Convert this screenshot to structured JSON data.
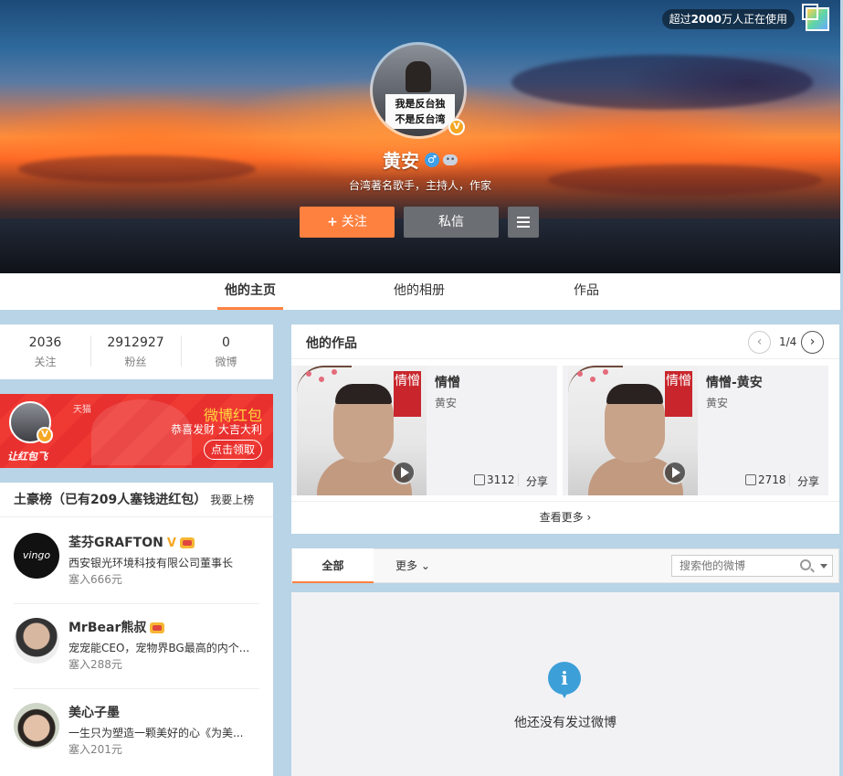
{
  "header": {
    "users_badge_prefix": "超过",
    "users_badge_bold": "2000",
    "users_badge_suffix": "万人正在使用",
    "avatar_sign_line1": "我是反台独",
    "avatar_sign_line2": "不是反台湾",
    "profile_name": "黄安",
    "gender_icon": "male-icon",
    "bio": "台湾著名歌手，主持人，作家",
    "follow_label": "关注",
    "message_label": "私信"
  },
  "nav": {
    "tabs": [
      "他的主页",
      "他的相册",
      "作品"
    ],
    "active": "他的主页"
  },
  "stats": [
    {
      "num": "2036",
      "label": "关注"
    },
    {
      "num": "2912927",
      "label": "粉丝"
    },
    {
      "num": "0",
      "label": "微博"
    }
  ],
  "redpacket": {
    "tmall": "天猫",
    "logo": "让红包飞",
    "title": "微博红包",
    "subtitle": "恭喜发财 大吉大利",
    "button": "点击领取"
  },
  "rich_list": {
    "title": "土豪榜（已有209人塞钱进红包）",
    "link": "我要上榜",
    "items": [
      {
        "name": "荃芬GRAFTON",
        "desc": "西安银光环境科技有限公司董事长",
        "amount": "塞入666元",
        "avatar_text": "vingo",
        "verified": "V"
      },
      {
        "name": "MrBear熊叔",
        "desc": "宠宠能CEO，宠物界BG最高的内个...",
        "amount": "塞入288元"
      },
      {
        "name": "美心子墨",
        "desc": "一生只为塑造一颗美好的心《为美...",
        "amount": "塞入201元"
      }
    ]
  },
  "works": {
    "title": "他的作品",
    "page": "1/4",
    "items": [
      {
        "title": "情憎",
        "artist": "黄安",
        "likes": "3112",
        "share": "分享",
        "seal": "情憎"
      },
      {
        "title": "情憎-黄安",
        "artist": "黄安",
        "likes": "2718",
        "share": "分享",
        "seal": "情憎"
      }
    ],
    "see_more": "查看更多"
  },
  "feed": {
    "tab_all": "全部",
    "tab_more": "更多",
    "search_placeholder": "搜索他的微博",
    "empty_text": "他还没有发过微博"
  },
  "colors": {
    "accent": "#ff8140",
    "verified": "#f5a623",
    "info": "#3d9fd8",
    "page_bg": "#b8d4e6"
  }
}
